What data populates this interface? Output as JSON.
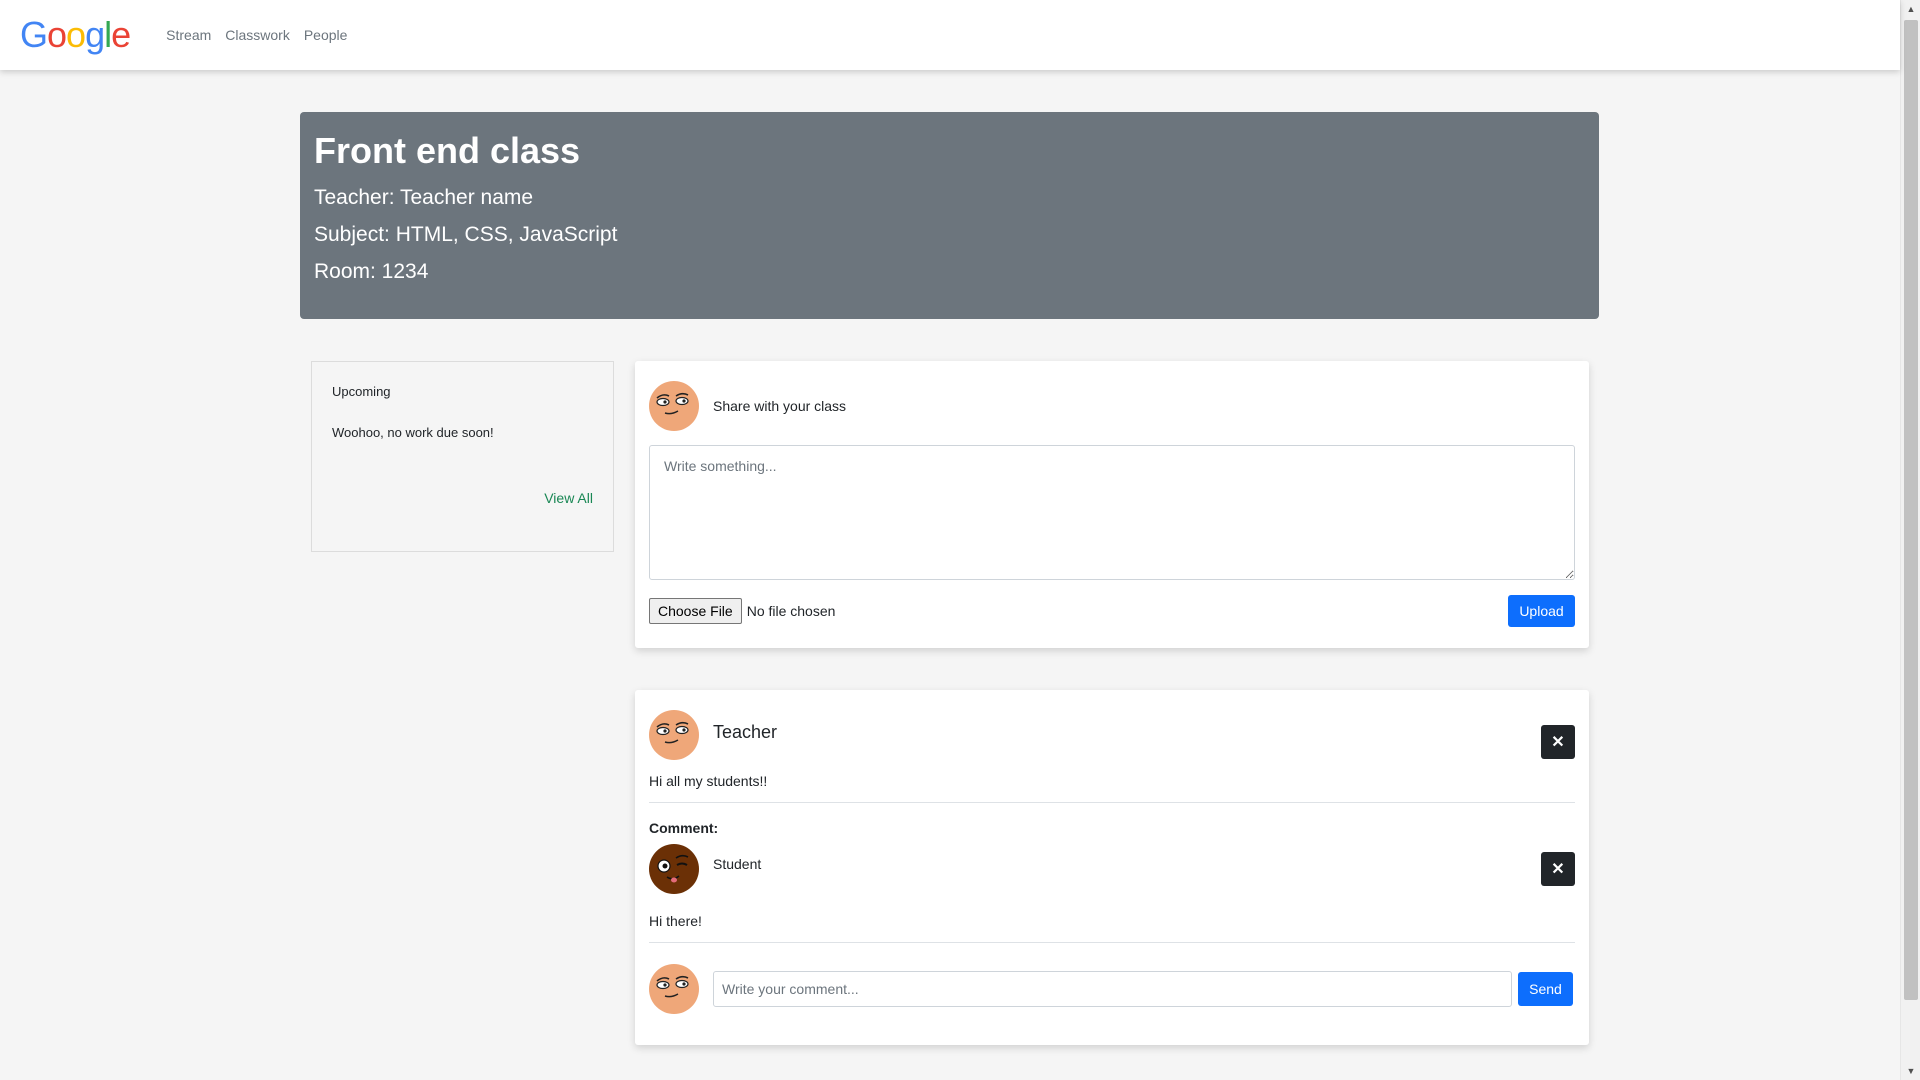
{
  "brand": {
    "letters": [
      "G",
      "o",
      "o",
      "g",
      "l",
      "e"
    ]
  },
  "colors": {
    "brand_blue": "#4285F4",
    "brand_red": "#EA4335",
    "brand_yellow": "#FBBC05",
    "brand_green": "#34A853",
    "banner": "#6c757d",
    "primary": "#0d6efd",
    "dark": "#212529",
    "link_green": "#198754",
    "avatar_teacher": "#efa779",
    "avatar_student": "#6b3006"
  },
  "nav": {
    "items": [
      "Stream",
      "Classwork",
      "People"
    ]
  },
  "banner": {
    "title": "Front end class",
    "teacher": "Teacher: Teacher name",
    "subject": "Subject: HTML, CSS, JavaScript",
    "room": "Room: 1234"
  },
  "upcoming": {
    "title": "Upcoming",
    "empty_text": "Woohoo, no work due soon!",
    "view_all": "View All"
  },
  "share": {
    "label": "Share with your class",
    "placeholder": "Write something...",
    "choose_file": "Choose File",
    "no_file": "No file chosen",
    "upload": "Upload"
  },
  "post": {
    "author": "Teacher",
    "body": "Hi all my students!!",
    "delete_glyph": "✕",
    "comment_label": "Comment:",
    "comment": {
      "author": "Student",
      "body": "Hi there!",
      "delete_glyph": "✕"
    },
    "reply_placeholder": "Write your comment...",
    "send": "Send"
  },
  "icons": [
    "teacher-avatar-icon",
    "student-avatar-icon",
    "close-icon",
    "scroll-up-icon",
    "scroll-down-icon"
  ]
}
